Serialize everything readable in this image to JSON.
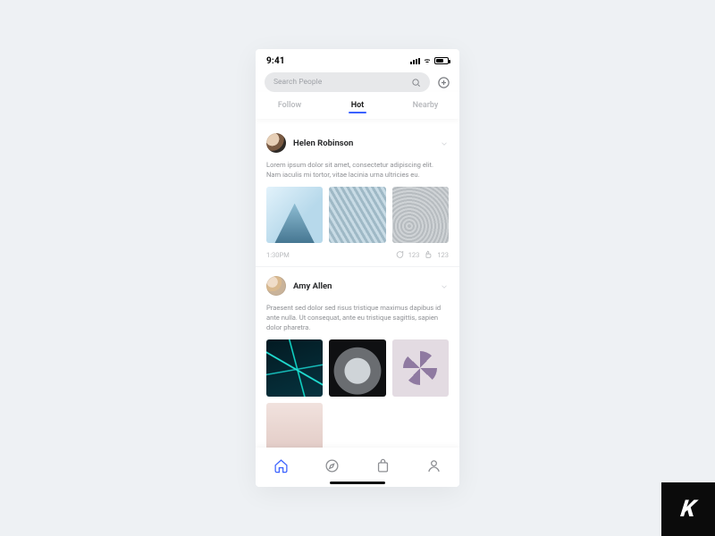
{
  "status": {
    "time": "9:41"
  },
  "search": {
    "placeholder": "Search People"
  },
  "tabs": [
    {
      "label": "Follow",
      "active": false
    },
    {
      "label": "Hot",
      "active": true
    },
    {
      "label": "Nearby",
      "active": false
    }
  ],
  "feed": [
    {
      "user": "Helen Robinson",
      "text": "Lorem ipsum dolor sit amet, consectetur adipiscing elit. Nam iaculis mi tortor, vitae lacinia urna ultricies eu.",
      "time": "1:30PM",
      "comments": "123",
      "likes": "123"
    },
    {
      "user": "Amy Allen",
      "text": "Praesent sed dolor sed risus tristique maximus dapibus id ante nulla. Ut consequat, ante eu tristique sagittis, sapien dolor pharetra."
    }
  ],
  "badge": {
    "letter": "K"
  }
}
